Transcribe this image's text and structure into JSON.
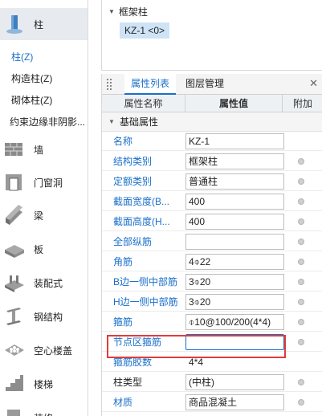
{
  "nav": {
    "items": [
      {
        "label": "柱",
        "icon": "column-icon",
        "active": true
      },
      {
        "label": "墙",
        "icon": "wall-icon",
        "active": false
      },
      {
        "label": "门窗洞",
        "icon": "door-window-icon",
        "active": false
      },
      {
        "label": "梁",
        "icon": "beam-icon",
        "active": false
      },
      {
        "label": "板",
        "icon": "slab-icon",
        "active": false
      },
      {
        "label": "装配式",
        "icon": "prefab-icon",
        "active": false
      },
      {
        "label": "钢结构",
        "icon": "steel-structure-icon",
        "active": false
      },
      {
        "label": "空心楼盖",
        "icon": "hollow-floor-icon",
        "active": false
      },
      {
        "label": "楼梯",
        "icon": "stairs-icon",
        "active": false
      },
      {
        "label": "装修",
        "icon": "decoration-icon",
        "active": false
      }
    ],
    "sub_items": [
      {
        "label": "柱(Z)",
        "active": true
      },
      {
        "label": "构造柱(Z)",
        "active": false
      },
      {
        "label": "砌体柱(Z)",
        "active": false
      },
      {
        "label": "约束边缘非阴影...",
        "active": false
      }
    ]
  },
  "tree": {
    "parent": "框架柱",
    "child": "KZ-1 <0>"
  },
  "panel": {
    "tabs": [
      "属性列表",
      "图层管理"
    ],
    "active_tab": 0,
    "headers": {
      "name": "属性名称",
      "value": "属性值",
      "extra": "附加"
    },
    "group": "基础属性",
    "rows": [
      {
        "name": "名称",
        "value": "KZ-1",
        "link": true,
        "box": true,
        "dot": false
      },
      {
        "name": "结构类别",
        "value": "框架柱",
        "link": true,
        "box": true,
        "dot": true
      },
      {
        "name": "定额类别",
        "value": "普通柱",
        "link": true,
        "box": true,
        "dot": true
      },
      {
        "name": "截面宽度(B...",
        "value": "400",
        "link": true,
        "box": true,
        "dot": true
      },
      {
        "name": "截面高度(H...",
        "value": "400",
        "link": true,
        "box": true,
        "dot": true
      },
      {
        "name": "全部纵筋",
        "value": "",
        "link": true,
        "box": true,
        "dot": true
      },
      {
        "name": "角筋",
        "value": "4⌽22",
        "link": true,
        "box": true,
        "dot": true
      },
      {
        "name": "B边一侧中部筋",
        "value": "3⌽20",
        "link": true,
        "box": true,
        "dot": true
      },
      {
        "name": "H边一侧中部筋",
        "value": "3⌽20",
        "link": true,
        "box": true,
        "dot": true
      },
      {
        "name": "箍筋",
        "value": "⌽10@100/200(4*4)",
        "link": true,
        "box": true,
        "dot": true
      },
      {
        "name": "节点区箍筋",
        "value": "",
        "link": true,
        "box": true,
        "dot": true,
        "focus": true
      },
      {
        "name": "箍筋胶数",
        "value": "4*4",
        "link": true,
        "box": false,
        "dot": false
      },
      {
        "name": "柱类型",
        "value": "(中柱)",
        "link": false,
        "box": true,
        "dot": true
      },
      {
        "name": "材质",
        "value": "商品混凝土",
        "link": true,
        "box": true,
        "dot": true
      }
    ]
  }
}
